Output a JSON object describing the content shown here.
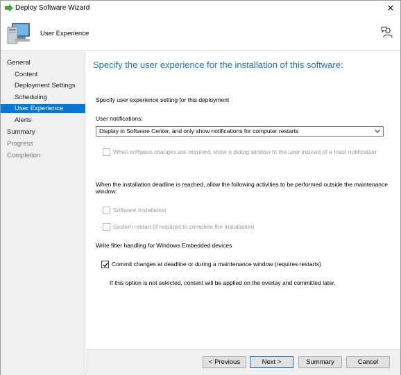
{
  "window": {
    "title": "Deploy Software Wizard",
    "close_glyph": "✕"
  },
  "header": {
    "title": "User Experience",
    "icon": "computer-icon",
    "help_icon": "help-person-icon"
  },
  "nav": {
    "items": [
      {
        "label": "General",
        "level": "top",
        "state": "normal"
      },
      {
        "label": "Content",
        "level": "sub",
        "state": "normal"
      },
      {
        "label": "Deployment Settings",
        "level": "sub",
        "state": "normal"
      },
      {
        "label": "Scheduling",
        "level": "sub",
        "state": "normal"
      },
      {
        "label": "User Experience",
        "level": "sub",
        "state": "active"
      },
      {
        "label": "Alerts",
        "level": "sub",
        "state": "normal"
      },
      {
        "label": "Summary",
        "level": "top",
        "state": "normal"
      },
      {
        "label": "Progress",
        "level": "top",
        "state": "disabled"
      },
      {
        "label": "Completion",
        "level": "top",
        "state": "disabled"
      }
    ]
  },
  "main": {
    "heading": "Specify the user experience for the installation of this software:",
    "intro": "Specify user experience setting for this deployment",
    "notifications_label": "User notifications:",
    "notifications_value": "Display in Software Center, and only show notifications for computer restarts",
    "dialog_option": "When software changes are required, show a dialog window to the user instead of a toast notification",
    "deadline_text_1": "When the installation deadline is reached, allow the following activities to be performed outside the maintenance",
    "deadline_text_2": "window:",
    "software_installation": "Software Installation",
    "system_restart": "System restart  (if required to complete the installation)",
    "write_filter_label": "Write filter handling for Windows Embedded devices",
    "commit_changes": "Commit changes at deadline or during a maintenance window (requires restarts)",
    "commit_note": "If this option is not selected, content will be applied on the overlay and committed later."
  },
  "buttons": {
    "previous": "< Previous",
    "next": "Next >",
    "summary": "Summary",
    "cancel": "Cancel"
  },
  "colors": {
    "accent": "#0078d7",
    "heading": "#1f6fbd",
    "nav_bg": "#f0f0f0"
  }
}
